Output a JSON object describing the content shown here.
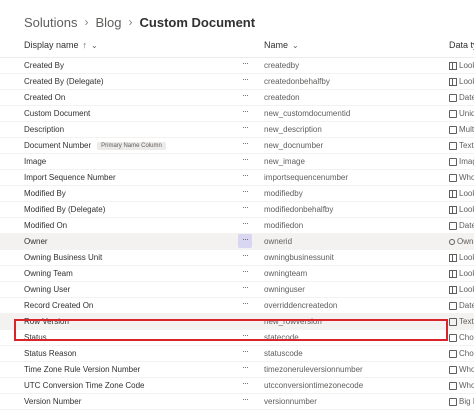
{
  "breadcrumb": {
    "items": [
      "Solutions",
      "Blog"
    ],
    "current": "Custom Document"
  },
  "columns": {
    "display_name": "Display name",
    "name": "Name",
    "data_type": "Data typ"
  },
  "rows": [
    {
      "display": "Created By",
      "name": "createdby",
      "type": "Looku",
      "icon": "lookup-icon"
    },
    {
      "display": "Created By (Delegate)",
      "name": "createdonbehalfby",
      "type": "Looku",
      "icon": "lookup-icon"
    },
    {
      "display": "Created On",
      "name": "createdon",
      "type": "Date",
      "icon": "date-icon"
    },
    {
      "display": "Custom Document",
      "name": "new_customdocumentid",
      "type": "Uniqu",
      "icon": "unique-id-icon"
    },
    {
      "display": "Description",
      "name": "new_description",
      "type": "Multi",
      "icon": "multiline-text-icon"
    },
    {
      "display": "Document Number",
      "badge": "Primary Name Column",
      "name": "new_docnumber",
      "type": "Text",
      "icon": "text-icon"
    },
    {
      "display": "Image",
      "name": "new_image",
      "type": "Image",
      "icon": "image-icon"
    },
    {
      "display": "Import Sequence Number",
      "name": "importsequencenumber",
      "type": "Whol",
      "icon": "whole-number-icon"
    },
    {
      "display": "Modified By",
      "name": "modifiedby",
      "type": "Looku",
      "icon": "lookup-icon"
    },
    {
      "display": "Modified By (Delegate)",
      "name": "modifiedonbehalfby",
      "type": "Looku",
      "icon": "lookup-icon"
    },
    {
      "display": "Modified On",
      "name": "modifiedon",
      "type": "Date",
      "icon": "date-icon"
    },
    {
      "display": "Owner",
      "name": "ownerid",
      "type": "Owne",
      "icon": "owner-icon",
      "selected": true
    },
    {
      "display": "Owning Business Unit",
      "name": "owningbusinessunit",
      "type": "Looku",
      "icon": "lookup-icon"
    },
    {
      "display": "Owning Team",
      "name": "owningteam",
      "type": "Looku",
      "icon": "lookup-icon"
    },
    {
      "display": "Owning User",
      "name": "owninguser",
      "type": "Looku",
      "icon": "lookup-icon"
    },
    {
      "display": "Record Created On",
      "name": "overriddencreatedon",
      "type": "Date",
      "icon": "date-icon"
    },
    {
      "display": "Row Version",
      "name": "new_rowversion",
      "type": "Text",
      "icon": "text-icon",
      "highlighted": true
    },
    {
      "display": "Status",
      "name": "statecode",
      "type": "Choi",
      "icon": "choice-icon"
    },
    {
      "display": "Status Reason",
      "name": "statuscode",
      "type": "Choi",
      "icon": "choice-icon"
    },
    {
      "display": "Time Zone Rule Version Number",
      "name": "timezoneruleversionnumber",
      "type": "Whol",
      "icon": "whole-number-icon"
    },
    {
      "display": "UTC Conversion Time Zone Code",
      "name": "utcconversiontimezonecode",
      "type": "Whol",
      "icon": "whole-number-icon"
    },
    {
      "display": "Version Number",
      "name": "versionnumber",
      "type": "Big In",
      "icon": "big-integer-icon"
    }
  ],
  "colors": {
    "highlight_border": "#d9242b",
    "selected_row": "#f3f2f1"
  }
}
